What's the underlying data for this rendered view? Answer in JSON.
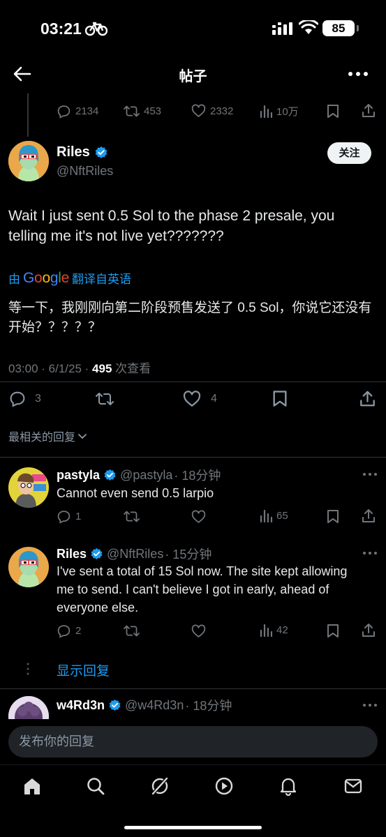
{
  "status_bar": {
    "time": "03:21",
    "battery": "85"
  },
  "nav": {
    "title": "帖子"
  },
  "prev_post": {
    "replies": "2134",
    "reposts": "453",
    "likes": "2332",
    "views": "10万"
  },
  "post": {
    "author_name": "Riles",
    "handle": "@NftRiles",
    "follow_label": "关注",
    "text": "Wait I just sent 0.5 Sol to the phase 2 presale, you telling me it's not live yet???????",
    "translate_prefix": "由",
    "translate_brand": "Google",
    "translate_label": "翻译自英语",
    "translated_text": "等一下，我刚刚向第二阶段预售发送了 0.5 Sol，你说它还没有开始？？？？？",
    "timestamp": "03:00 · 6/1/25 · ",
    "views_count": "495",
    "views_label": " 次查看",
    "replies": "3",
    "likes": "4"
  },
  "sort": {
    "label": "最相关的回复"
  },
  "replies": [
    {
      "name": "pastyla",
      "handle": "@pastyla",
      "time": "· 18分钟",
      "text": "Cannot even send 0.5 larpio",
      "replies": "1",
      "reposts": "",
      "likes": "",
      "views": "65"
    },
    {
      "name": "Riles",
      "handle": "@NftRiles",
      "time": "· 15分钟",
      "text": "I've sent a total of 15 Sol now. The site kept allowing me to send. I can't believe I got in early, ahead of everyone else.",
      "replies": "2",
      "reposts": "",
      "likes": "",
      "views": "42"
    },
    {
      "name": "w4Rd3n",
      "handle": "@w4Rd3n",
      "time": "· 18分钟"
    }
  ],
  "show_replies": "显示回复",
  "composer": {
    "placeholder": "发布你的回复"
  },
  "colors": {
    "accent": "#1d9bf0",
    "background": "#000000",
    "muted": "#71767b"
  }
}
